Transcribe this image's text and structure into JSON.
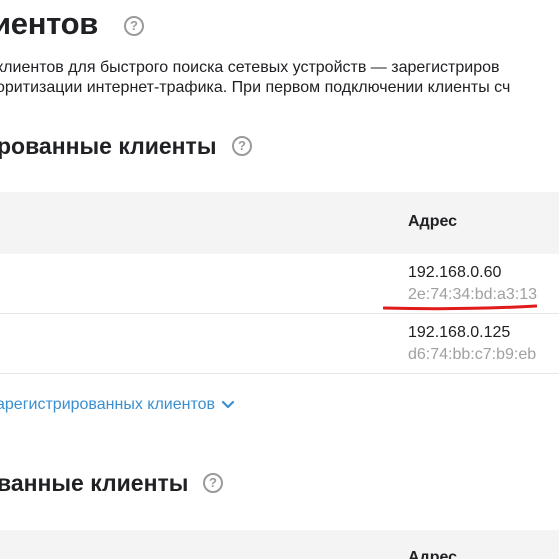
{
  "page": {
    "title": "иентов",
    "help_glyph": "?",
    "description_line1": "клиентов для быстрого поиска сетевых устройств — зарегистриров",
    "description_line2": "оритизации интернет-трафика. При первом подключении клиенты сч"
  },
  "registered": {
    "title": "рованные клиенты",
    "help_glyph": "?",
    "columns": {
      "address": "Адрес"
    },
    "rows": [
      {
        "ip": "192.168.0.60",
        "mac": "2e:74:34:bd:a3:13"
      },
      {
        "ip": "192.168.0.125",
        "mac": "d6:74:bb:c7:b9:eb"
      }
    ],
    "expand_link": "арегистрированных клиентов",
    "annotation_color": "#e01b1b"
  },
  "unregistered": {
    "title": "ванные клиенты",
    "help_glyph": "?",
    "columns": {
      "address": "Адрес"
    }
  },
  "colors": {
    "link": "#3a8fd0",
    "muted": "#a0a0a0",
    "header_bg": "#f4f4f4"
  }
}
